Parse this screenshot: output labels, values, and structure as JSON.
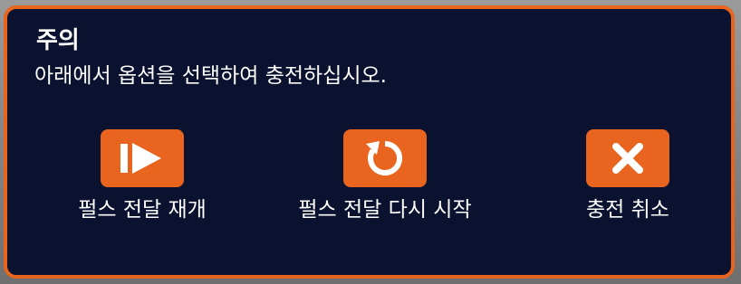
{
  "dialog": {
    "title": "주의",
    "message": "아래에서 옵션을 선택하여 충전하십시오."
  },
  "actions": [
    {
      "id": "resume",
      "label": "펄스 전달 재개",
      "icon": "resume-play-icon"
    },
    {
      "id": "restart",
      "label": "펄스 전달 다시 시작",
      "icon": "restart-circular-arrow-icon"
    },
    {
      "id": "cancel",
      "label": "충전 취소",
      "icon": "close-x-icon"
    }
  ],
  "colors": {
    "accent": "#e8641f",
    "dialog_background": "#0b1230",
    "text": "#ffffff"
  }
}
